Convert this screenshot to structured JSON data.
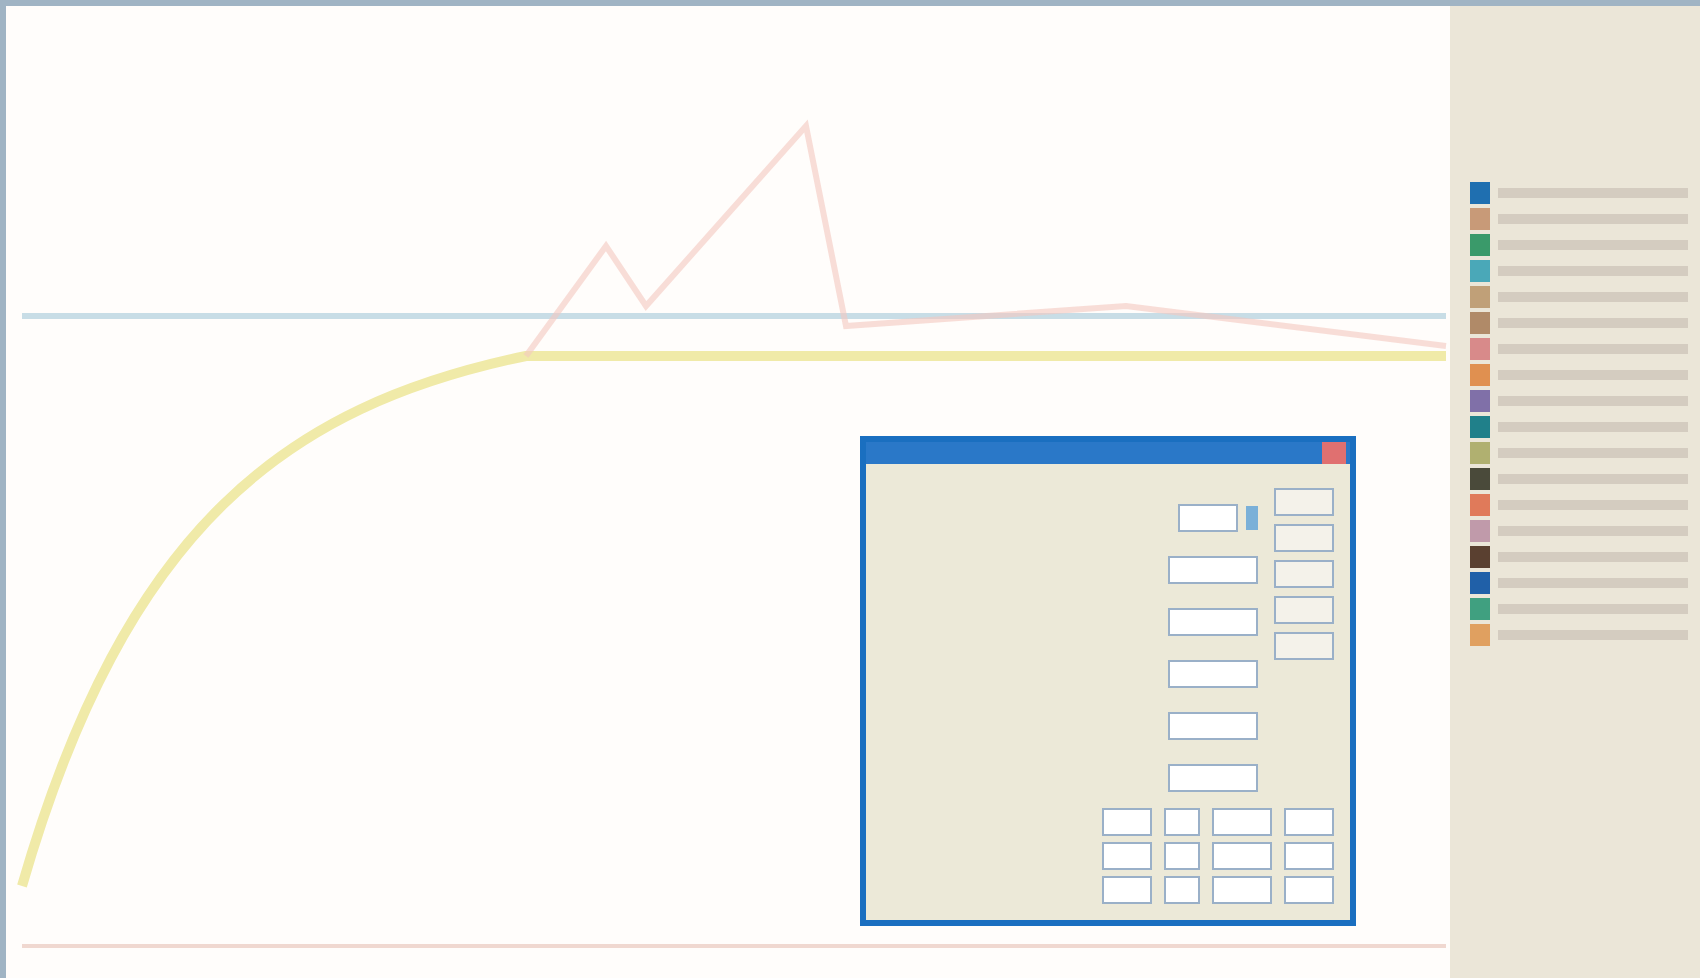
{
  "legend": {
    "items": [
      {
        "color": "#1f6fb0"
      },
      {
        "color": "#c89a78"
      },
      {
        "color": "#3a9a6a"
      },
      {
        "color": "#4aa8b8"
      },
      {
        "color": "#c0a078"
      },
      {
        "color": "#b08a68"
      },
      {
        "color": "#d88a8a"
      },
      {
        "color": "#e09050"
      },
      {
        "color": "#8070a8"
      },
      {
        "color": "#20808a"
      },
      {
        "color": "#b0b070"
      },
      {
        "color": "#4a4a3a"
      },
      {
        "color": "#e07a5a"
      },
      {
        "color": "#c09aaa"
      },
      {
        "color": "#5a4030"
      },
      {
        "color": "#2060a8"
      },
      {
        "color": "#40a080"
      },
      {
        "color": "#e0a060"
      }
    ]
  }
}
